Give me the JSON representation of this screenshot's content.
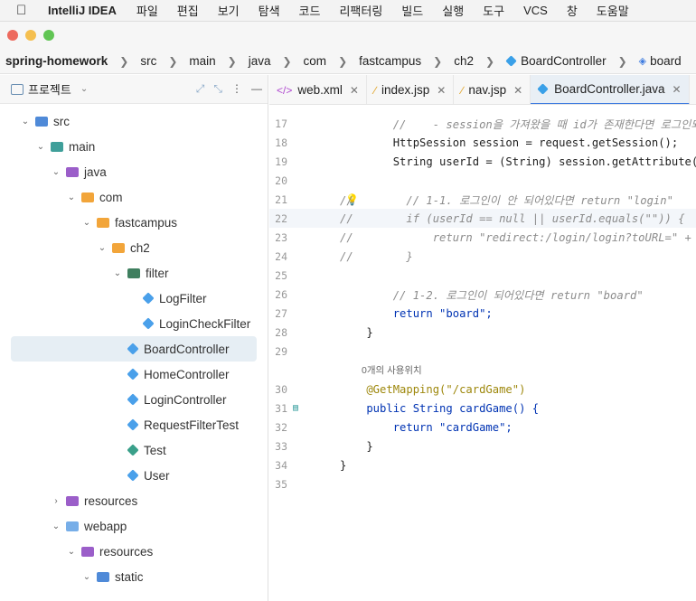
{
  "menubar": {
    "app_name": "IntelliJ IDEA",
    "items": [
      "파일",
      "편집",
      "보기",
      "탐색",
      "코드",
      "리팩터링",
      "빌드",
      "실행",
      "도구",
      "VCS",
      "창",
      "도움말"
    ]
  },
  "breadcrumb": {
    "project": "spring-homework",
    "path": [
      "src",
      "main",
      "java",
      "com",
      "fastcampus",
      "ch2",
      "BoardController",
      "board"
    ]
  },
  "project_panel": {
    "title": "프로젝트",
    "tree": [
      {
        "label": "src",
        "icon": "folder-blue",
        "expanded": true
      },
      {
        "label": "main",
        "icon": "folder-teal",
        "expanded": true
      },
      {
        "label": "java",
        "icon": "folder-purple",
        "expanded": true
      },
      {
        "label": "com",
        "icon": "folder-orange",
        "expanded": true
      },
      {
        "label": "fastcampus",
        "icon": "folder-orange",
        "expanded": true
      },
      {
        "label": "ch2",
        "icon": "folder-orange",
        "expanded": true
      },
      {
        "label": "filter",
        "icon": "package-green",
        "expanded": true
      },
      {
        "label": "LogFilter",
        "icon": "class"
      },
      {
        "label": "LoginCheckFilter",
        "icon": "class"
      },
      {
        "label": "BoardController",
        "icon": "class",
        "selected": true
      },
      {
        "label": "HomeController",
        "icon": "class"
      },
      {
        "label": "LoginController",
        "icon": "class"
      },
      {
        "label": "RequestFilterTest",
        "icon": "class"
      },
      {
        "label": "Test",
        "icon": "test-class"
      },
      {
        "label": "User",
        "icon": "class"
      },
      {
        "label": "resources",
        "icon": "folder-purple",
        "expanded": false
      },
      {
        "label": "webapp",
        "icon": "folder-lblue",
        "expanded": true
      },
      {
        "label": "resources",
        "icon": "folder-purple",
        "expanded": true
      },
      {
        "label": "static",
        "icon": "folder-blue",
        "expanded": true
      }
    ]
  },
  "tabs": [
    {
      "label": "web.xml",
      "icon": "xml-icon"
    },
    {
      "label": "index.jsp",
      "icon": "jsp-icon"
    },
    {
      "label": "nav.jsp",
      "icon": "jsp-icon"
    },
    {
      "label": "BoardController.java",
      "icon": "class-icon",
      "active": true
    }
  ],
  "code": {
    "lines": [
      {
        "n": "17",
        "t": "        //    - session을 가져왔을 때 id가 존재한다면 로그인되어있는"
      },
      {
        "n": "18",
        "t": "        HttpSession session = request.getSession();"
      },
      {
        "n": "19",
        "t": "        String userId = (String) session.getAttribute( s:"
      },
      {
        "n": "20",
        "t": ""
      },
      {
        "n": "21",
        "t": "//        // 1-1. 로그인이 안 되어있다면 return \"login\""
      },
      {
        "n": "22",
        "t": "//        if (userId == null || userId.equals(\"\")) {"
      },
      {
        "n": "23",
        "t": "//            return \"redirect:/login/login?toURL=\" + req"
      },
      {
        "n": "24",
        "t": "//        }"
      },
      {
        "n": "25",
        "t": ""
      },
      {
        "n": "26",
        "t": "        // 1-2. 로그인이 되어있다면 return \"board\""
      },
      {
        "n": "27",
        "t": "        return \"board\";"
      },
      {
        "n": "28",
        "t": "    }"
      },
      {
        "n": "29",
        "t": ""
      },
      {
        "n": "30",
        "t": "    @GetMapping(\"/cardGame\")"
      },
      {
        "n": "31",
        "t": "    public String cardGame() {"
      },
      {
        "n": "32",
        "t": "        return \"cardGame\";"
      },
      {
        "n": "33",
        "t": "    }"
      },
      {
        "n": "34",
        "t": "}"
      },
      {
        "n": "35",
        "t": ""
      }
    ],
    "usage_hint": "0개의 사용위치"
  },
  "colors": {
    "keyword": "#0033b3",
    "string": "#067d17",
    "comment": "#8c8c8c",
    "annotation": "#9e880d"
  }
}
